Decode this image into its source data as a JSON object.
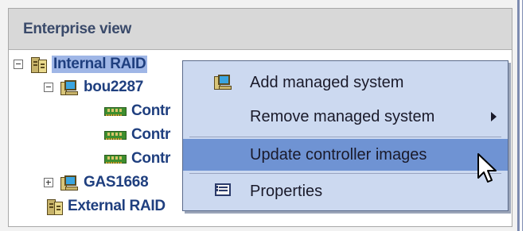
{
  "panel": {
    "title": "Enterprise view"
  },
  "tree": [
    {
      "label": "Internal RAID",
      "icon": "storage-cabinet-icon",
      "toggle": "collapse",
      "selected": true
    },
    {
      "label": "bou2287",
      "icon": "computer-icon",
      "toggle": "collapse"
    },
    {
      "label": "Contr",
      "icon": "controller-card-icon"
    },
    {
      "label": "Contr",
      "icon": "controller-card-icon"
    },
    {
      "label": "Contr",
      "icon": "controller-card-icon"
    },
    {
      "label": "GAS1668",
      "icon": "computer-icon",
      "toggle": "expand"
    },
    {
      "label": "External RAID",
      "icon": "storage-cabinet-icon"
    }
  ],
  "context_menu": {
    "items": [
      {
        "label": "Add managed system",
        "icon": "computer-icon"
      },
      {
        "label": "Remove managed system",
        "has_submenu": true
      },
      {
        "label": "Update controller images",
        "highlighted": true
      },
      {
        "label": "Properties",
        "icon": "properties-icon"
      }
    ]
  },
  "colors": {
    "menu_bg": "#ccd9f0",
    "menu_highlight": "#6f93d3",
    "tree_text": "#1f3f7f",
    "selection": "#9fb6e6"
  }
}
